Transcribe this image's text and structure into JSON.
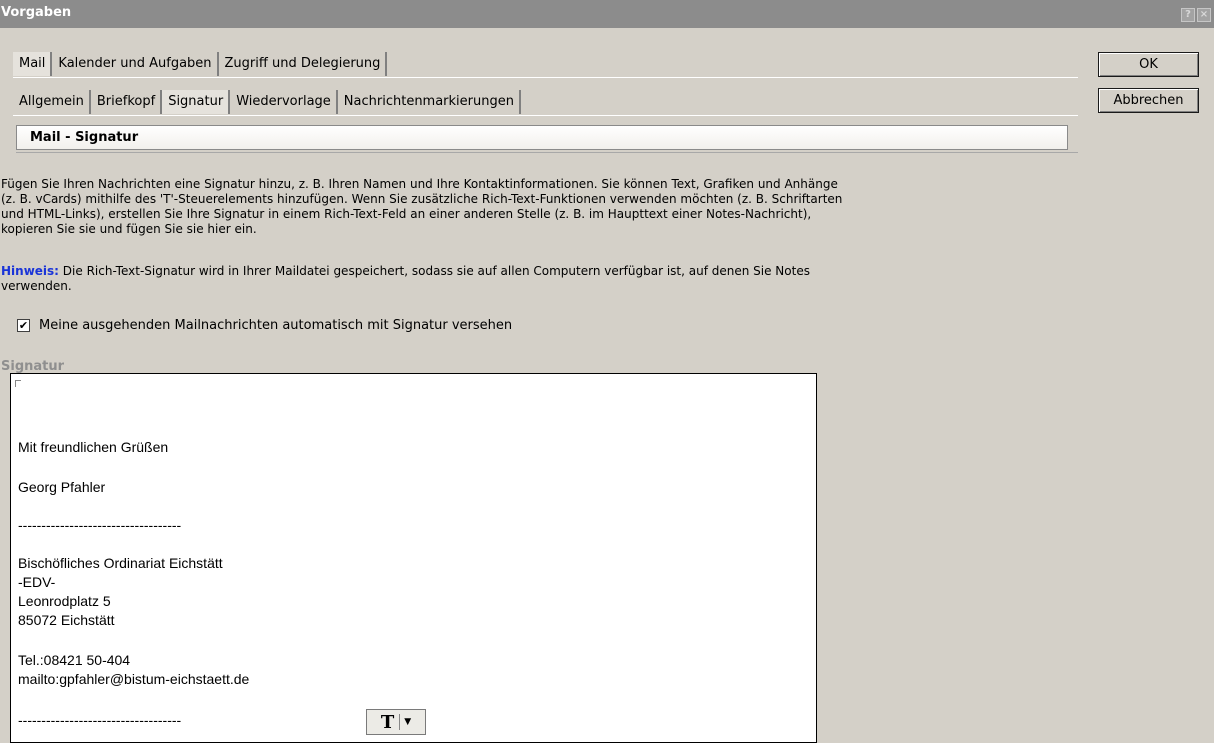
{
  "window": {
    "title": "Vorgaben",
    "help_btn": "?",
    "close_btn": "×"
  },
  "tabs_main": [
    "Mail",
    "Kalender und Aufgaben",
    "Zugriff und Delegierung"
  ],
  "tabs_sub": [
    "Allgemein",
    "Briefkopf",
    "Signatur",
    "Wiedervorlage",
    "Nachrichtenmarkierungen"
  ],
  "active_main_tab": "Mail",
  "active_sub_tab": "Signatur",
  "section_title": "Mail - Signatur",
  "intro": {
    "line1": "Fügen Sie Ihren Nachrichten eine Signatur hinzu, z. B. Ihren Namen und Ihre Kontaktinformationen. Sie können Text, Grafiken und Anhänge",
    "line2": "(z. B. vCards) mithilfe des 'T'-Steuerelements hinzufügen. Wenn Sie zusätzliche Rich-Text-Funktionen verwenden möchten (z. B. Schriftarten",
    "line3": "und HTML-Links), erstellen Sie Ihre Signatur in einem Rich-Text-Feld an einer anderen Stelle (z. B. im Haupttext einer Notes-Nachricht),",
    "line4": "kopieren Sie sie und fügen Sie sie hier ein."
  },
  "hint": {
    "label": "Hinweis:",
    "line1": " Die Rich-Text-Signatur wird in Ihrer Maildatei gespeichert, sodass sie auf allen Computern verfügbar ist, auf denen Sie Notes",
    "line2": "verwenden."
  },
  "auto_signature": {
    "checked": true,
    "mark": "✔",
    "label": "Meine ausgehenden Mailnachrichten automatisch mit Signatur versehen"
  },
  "signature": {
    "label": "Signatur",
    "greeting": "Mit freundlichen Grüßen",
    "name": "Georg Pfahler",
    "separator": "-----------------------------------",
    "org": "Bischöfliches Ordinariat Eichstätt",
    "dept": "-EDV-",
    "street": "Leonrodplatz 5",
    "city": "85072 Eichstätt",
    "tel": "Tel.:08421 50-404",
    "mail": "mailto:gpfahler@bistum-eichstaett.de",
    "separator2": "-----------------------------------"
  },
  "richtext_button": {
    "label": "T",
    "arrow": "▼"
  },
  "buttons": {
    "ok": "OK",
    "cancel": "Abbrechen"
  }
}
